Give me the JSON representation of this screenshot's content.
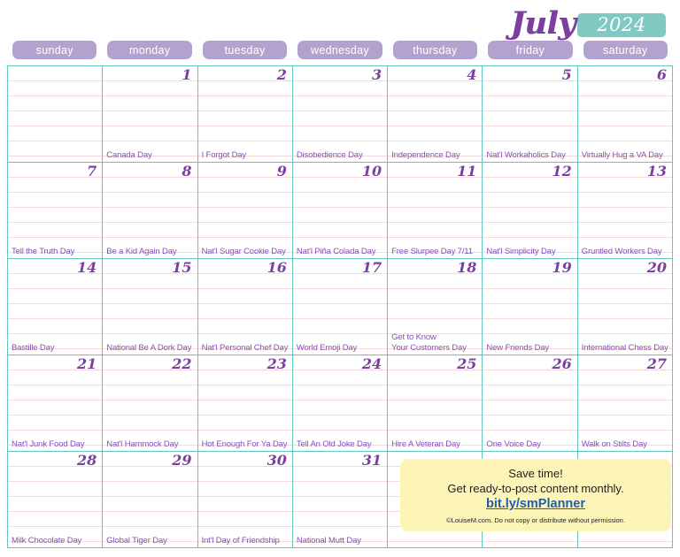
{
  "header": {
    "month": "July",
    "year": "2024",
    "month_color": "#7b3fa0",
    "year_bg_color": "#7fc9c0"
  },
  "weekdays": [
    "sunday",
    "monday",
    "tuesday",
    "wednesday",
    "thursday",
    "friday",
    "saturday"
  ],
  "theme": {
    "grid_border_color": "#63c6bc",
    "rule_line_color": "#f7d8da",
    "weekday_pill_color": "#b4a2ce",
    "date_number_color": "#7b3fa0",
    "event_text_color": "#8a4fb5",
    "promo_bg_color": "#fdf4b8",
    "promo_link_color": "#1f5fb0"
  },
  "cells": [
    {
      "date": "",
      "event": ""
    },
    {
      "date": "1",
      "event": "Canada Day"
    },
    {
      "date": "2",
      "event": "I Forgot Day"
    },
    {
      "date": "3",
      "event": "Disobedience Day"
    },
    {
      "date": "4",
      "event": "Independence Day"
    },
    {
      "date": "5",
      "event": "Nat'l Workaholics Day"
    },
    {
      "date": "6",
      "event": "Virtually Hug a VA Day"
    },
    {
      "date": "7",
      "event": "Tell the Truth Day"
    },
    {
      "date": "8",
      "event": "Be a Kid Again Day"
    },
    {
      "date": "9",
      "event": "Nat'l Sugar Cookie Day"
    },
    {
      "date": "10",
      "event": "Nat'l Piña Colada Day"
    },
    {
      "date": "11",
      "event": "Free Slurpee Day 7/11"
    },
    {
      "date": "12",
      "event": "Nat'l Simplicity Day"
    },
    {
      "date": "13",
      "event": "Gruntled Workers Day"
    },
    {
      "date": "14",
      "event": "Bastille Day"
    },
    {
      "date": "15",
      "event": "National Be A Dork Day"
    },
    {
      "date": "16",
      "event": "Nat'l Personal Chef Day"
    },
    {
      "date": "17",
      "event": "World Emoji Day"
    },
    {
      "date": "18",
      "event": "Get to Know\nYour Customers Day"
    },
    {
      "date": "19",
      "event": "New Friends Day"
    },
    {
      "date": "20",
      "event": "International Chess Day"
    },
    {
      "date": "21",
      "event": "Nat'l Junk Food Day"
    },
    {
      "date": "22",
      "event": "Nat'l Hammock Day"
    },
    {
      "date": "23",
      "event": "Hot Enough For Ya Day"
    },
    {
      "date": "24",
      "event": "Tell An Old Joke Day"
    },
    {
      "date": "25",
      "event": "Hire A Veteran Day"
    },
    {
      "date": "26",
      "event": "One Voice Day"
    },
    {
      "date": "27",
      "event": "Walk on Stilts Day"
    },
    {
      "date": "28",
      "event": "Milk Chocolate Day"
    },
    {
      "date": "29",
      "event": "Global Tiger Day"
    },
    {
      "date": "30",
      "event": "Int'l Day of Friendship"
    },
    {
      "date": "31",
      "event": "National Mutt Day"
    },
    {
      "date": "",
      "event": ""
    },
    {
      "date": "",
      "event": ""
    },
    {
      "date": "",
      "event": ""
    }
  ],
  "promo": {
    "line1": "Save time!",
    "line2": "Get ready-to-post content monthly.",
    "link": "bit.ly/smPlanner",
    "copyright": "©LouiseM.com. Do not copy or distribute without permission."
  }
}
